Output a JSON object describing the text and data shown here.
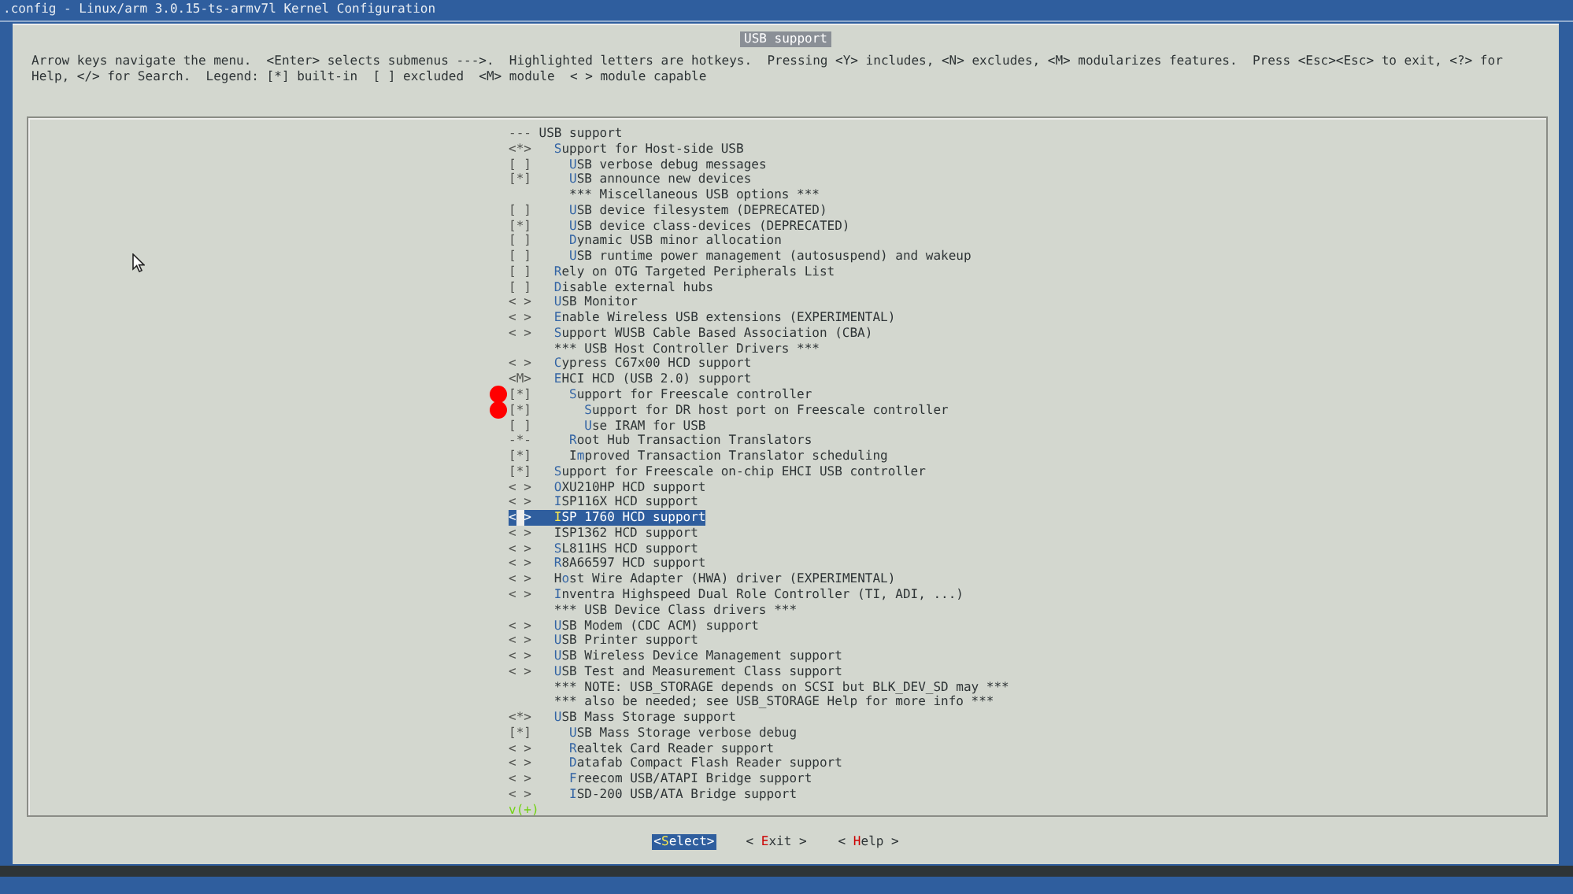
{
  "window": {
    "title": ".config - Linux/arm 3.0.15-ts-armv7l Kernel Configuration"
  },
  "dialog": {
    "title": "USB support",
    "help_lines": [
      "Arrow keys navigate the menu.  <Enter> selects submenus --->.  Highlighted letters are hotkeys.  Pressing <Y> includes, <N> excludes, <M> modularizes features.  Press <Esc><Esc> to exit, <?> for",
      "Help, </> for Search.  Legend: [*] built-in  [ ] excluded  <M> module  < > module capable"
    ],
    "items": [
      {
        "kind": "menu",
        "indicator": "---",
        "label": "USB support",
        "selected": false
      },
      {
        "kind": "option",
        "indicator": "<*>",
        "hotkey": "S",
        "label": "upport for Host-side USB",
        "selected": false,
        "children": [
          {
            "kind": "option",
            "indicator": "[ ]",
            "hotkey": "U",
            "label": "SB verbose debug messages",
            "selected": false
          },
          {
            "kind": "option",
            "indicator": "[*]",
            "hotkey": "U",
            "label": "SB announce new devices",
            "selected": false
          },
          {
            "kind": "comment",
            "label": "*** Miscellaneous USB options ***",
            "selected": false
          },
          {
            "kind": "option",
            "indicator": "[ ]",
            "hotkey": "U",
            "label": "SB device filesystem (DEPRECATED)",
            "selected": false
          },
          {
            "kind": "option",
            "indicator": "[*]",
            "hotkey": "U",
            "label": "SB device class-devices (DEPRECATED)",
            "selected": false
          },
          {
            "kind": "option",
            "indicator": "[ ]",
            "hotkey": "D",
            "label": "ynamic USB minor allocation",
            "selected": false
          },
          {
            "kind": "option",
            "indicator": "[ ]",
            "hotkey": "U",
            "label": "SB runtime power management (autosuspend) and wakeup",
            "selected": false
          }
        ]
      },
      {
        "kind": "option",
        "indicator": "[ ]",
        "hotkey": "R",
        "label": "ely on OTG Targeted Peripherals List",
        "selected": false
      },
      {
        "kind": "option",
        "indicator": "[ ]",
        "hotkey": "D",
        "label": "isable external hubs",
        "selected": false
      },
      {
        "kind": "option",
        "indicator": "< >",
        "hotkey": "U",
        "label": "SB Monitor",
        "selected": false
      },
      {
        "kind": "option",
        "indicator": "< >",
        "hotkey": "E",
        "label": "nable Wireless USB extensions (EXPERIMENTAL)",
        "selected": false
      },
      {
        "kind": "option",
        "indicator": "< >",
        "hotkey": "S",
        "label": "upport WUSB Cable Based Association (CBA)",
        "selected": false
      },
      {
        "kind": "comment",
        "label": "*** USB Host Controller Drivers ***",
        "selected": false
      },
      {
        "kind": "option",
        "indicator": "< >",
        "hotkey": "C",
        "label": "ypress C67x00 HCD support",
        "selected": false
      },
      {
        "kind": "option",
        "indicator": "<M>",
        "hotkey": "E",
        "label": "HCI HCD (USB 2.0) support",
        "selected": false,
        "children": [
          {
            "kind": "option",
            "indicator": "[*]",
            "hotkey": "S",
            "label": "upport for Freescale controller",
            "selected": false,
            "marked": true,
            "children": [
              {
                "kind": "option",
                "indicator": "[*]",
                "hotkey": "S",
                "label": "upport for DR host port on Freescale controller",
                "selected": false,
                "marked": true
              },
              {
                "kind": "option",
                "indicator": "[ ]",
                "hotkey": "U",
                "label": "se IRAM for USB",
                "selected": false
              }
            ]
          },
          {
            "kind": "option",
            "indicator": "-*-",
            "hotkey": "R",
            "label": "oot Hub Transaction Translators",
            "selected": false
          },
          {
            "kind": "option",
            "indicator": "[*]",
            "before": "I",
            "hotkey": "m",
            "label": "proved Transaction Translator scheduling",
            "selected": false
          }
        ]
      },
      {
        "kind": "option",
        "indicator": "[*]",
        "hotkey": "S",
        "label": "upport for Freescale on-chip EHCI USB controller",
        "selected": false
      },
      {
        "kind": "option",
        "indicator": "< >",
        "hotkey": "O",
        "label": "XU210HP HCD support",
        "selected": false
      },
      {
        "kind": "option",
        "indicator": "< >",
        "hotkey": "I",
        "label": "SP116X HCD support",
        "selected": false
      },
      {
        "kind": "option",
        "indicator": "< >",
        "hotkey": "I",
        "label": "SP 1760 HCD support",
        "selected": true
      },
      {
        "kind": "option",
        "indicator": "< >",
        "label": "ISP1362 HCD support",
        "selected": false
      },
      {
        "kind": "option",
        "indicator": "< >",
        "hotkey": "S",
        "label": "L811HS HCD support",
        "selected": false
      },
      {
        "kind": "option",
        "indicator": "< >",
        "hotkey": "R",
        "label": "8A66597 HCD support",
        "selected": false
      },
      {
        "kind": "option",
        "indicator": "< >",
        "before": "H",
        "hotkey": "o",
        "label": "st Wire Adapter (HWA) driver (EXPERIMENTAL)",
        "selected": false
      },
      {
        "kind": "option",
        "indicator": "< >",
        "hotkey": "I",
        "label": "nventra Highspeed Dual Role Controller (TI, ADI, ...)",
        "selected": false
      },
      {
        "kind": "comment",
        "label": "*** USB Device Class drivers ***",
        "selected": false
      },
      {
        "kind": "option",
        "indicator": "< >",
        "hotkey": "U",
        "label": "SB Modem (CDC ACM) support",
        "selected": false
      },
      {
        "kind": "option",
        "indicator": "< >",
        "hotkey": "U",
        "label": "SB Printer support",
        "selected": false
      },
      {
        "kind": "option",
        "indicator": "< >",
        "hotkey": "U",
        "label": "SB Wireless Device Management support",
        "selected": false
      },
      {
        "kind": "option",
        "indicator": "< >",
        "hotkey": "U",
        "label": "SB Test and Measurement Class support",
        "selected": false
      },
      {
        "kind": "comment",
        "label": "*** NOTE: USB_STORAGE depends on SCSI but BLK_DEV_SD may ***",
        "selected": false
      },
      {
        "kind": "comment",
        "label": "*** also be needed; see USB_STORAGE Help for more info ***",
        "selected": false
      },
      {
        "kind": "option",
        "indicator": "<*>",
        "hotkey": "U",
        "label": "SB Mass Storage support",
        "selected": false,
        "children": [
          {
            "kind": "option",
            "indicator": "[*]",
            "hotkey": "U",
            "label": "SB Mass Storage verbose debug",
            "selected": false
          },
          {
            "kind": "option",
            "indicator": "< >",
            "hotkey": "R",
            "label": "ealtek Card Reader support",
            "selected": false
          },
          {
            "kind": "option",
            "indicator": "< >",
            "hotkey": "D",
            "label": "atafab Compact Flash Reader support",
            "selected": false
          },
          {
            "kind": "option",
            "indicator": "< >",
            "hotkey": "F",
            "label": "reecom USB/ATAPI Bridge support",
            "selected": false
          },
          {
            "kind": "option",
            "indicator": "< >",
            "hotkey": "I",
            "label": "SD-200 USB/ATA Bridge support",
            "selected": false
          }
        ]
      }
    ],
    "more_indicator": "v(+)",
    "buttons": [
      {
        "before": "<",
        "hotkey": "S",
        "after": "elect>",
        "selected": true
      },
      {
        "before": "< ",
        "hotkey": "E",
        "after": "xit >",
        "selected": false
      },
      {
        "before": "< ",
        "hotkey": "H",
        "after": "elp >",
        "selected": false
      }
    ]
  }
}
